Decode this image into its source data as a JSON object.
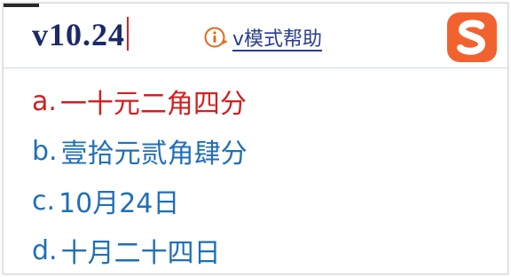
{
  "input": {
    "value": "v10.24"
  },
  "help": {
    "label": "v模式帮助",
    "icon": "info-icon"
  },
  "logo": {
    "icon": "sogou-logo-icon",
    "color": "#f2622f"
  },
  "colors": {
    "selected": "#d02020",
    "candidate": "#1f6fb8",
    "input": "#1b2a6b",
    "caret": "#d22323"
  },
  "candidates": [
    {
      "index": "a.",
      "text": "一十元二角四分"
    },
    {
      "index": "b.",
      "text": "壹拾元贰角肆分"
    },
    {
      "index": "c.",
      "text": "10月24日"
    },
    {
      "index": "d.",
      "text": "十月二十四日"
    }
  ]
}
